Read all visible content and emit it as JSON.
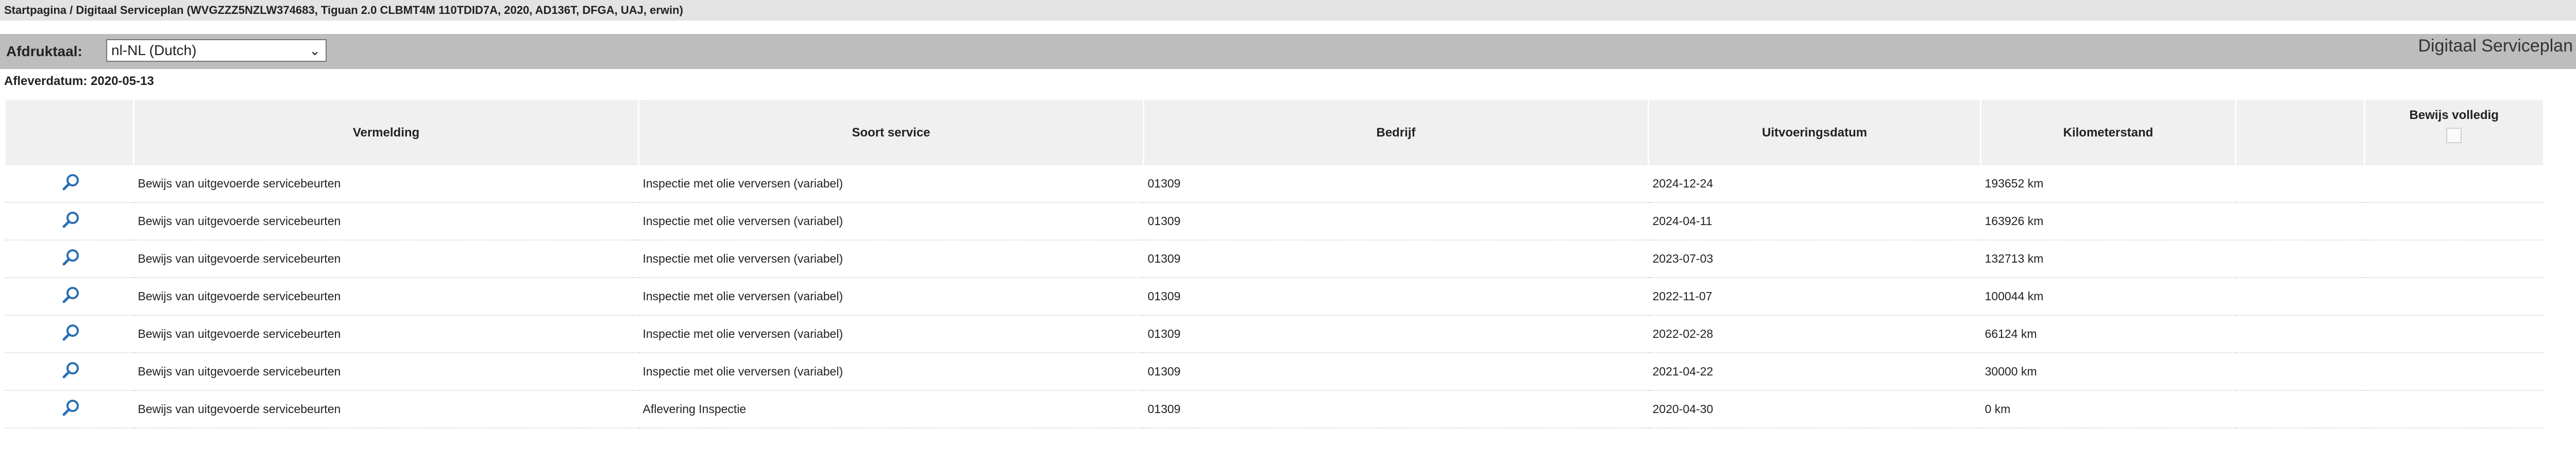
{
  "breadcrumb": "Startpagina / Digitaal Serviceplan (WVGZZZ5NZLW374683, Tiguan 2.0 CLBMT4M 110TDID7A, 2020, AD136T, DFGA, UAJ, erwin)",
  "toolbar": {
    "lang_label": "Afdruktaal:",
    "lang_value": "nl-NL (Dutch)",
    "title": "Digitaal Serviceplan"
  },
  "delivery_date": "Afleverdatum: 2020-05-13",
  "table": {
    "headers": {
      "vermelding": "Vermelding",
      "soort": "Soort service",
      "bedrijf": "Bedrijf",
      "datum": "Uitvoeringsdatum",
      "km": "Kilometerstand",
      "bewijs": "Bewijs volledig"
    },
    "rows": [
      {
        "vermelding": "Bewijs van uitgevoerde servicebeurten",
        "soort": "Inspectie met olie verversen (variabel)",
        "bedrijf": "01309",
        "datum": "2024-12-24",
        "km": "193652 km"
      },
      {
        "vermelding": "Bewijs van uitgevoerde servicebeurten",
        "soort": "Inspectie met olie verversen (variabel)",
        "bedrijf": "01309",
        "datum": "2024-04-11",
        "km": "163926 km"
      },
      {
        "vermelding": "Bewijs van uitgevoerde servicebeurten",
        "soort": "Inspectie met olie verversen (variabel)",
        "bedrijf": "01309",
        "datum": "2023-07-03",
        "km": "132713 km"
      },
      {
        "vermelding": "Bewijs van uitgevoerde servicebeurten",
        "soort": "Inspectie met olie verversen (variabel)",
        "bedrijf": "01309",
        "datum": "2022-11-07",
        "km": "100044 km"
      },
      {
        "vermelding": "Bewijs van uitgevoerde servicebeurten",
        "soort": "Inspectie met olie verversen (variabel)",
        "bedrijf": "01309",
        "datum": "2022-02-28",
        "km": "66124 km"
      },
      {
        "vermelding": "Bewijs van uitgevoerde servicebeurten",
        "soort": "Inspectie met olie verversen (variabel)",
        "bedrijf": "01309",
        "datum": "2021-04-22",
        "km": "30000 km"
      },
      {
        "vermelding": "Bewijs van uitgevoerde servicebeurten",
        "soort": "Aflevering Inspectie",
        "bedrijf": "01309",
        "datum": "2020-04-30",
        "km": "0 km"
      }
    ]
  },
  "icons": {
    "row_icon": "magnifier-icon",
    "select_chevron": "chevron-down-icon"
  },
  "colors": {
    "icon": "#2a6fb4",
    "header_bg": "#f0f0f0",
    "toolbar_bg": "#bdbdbd",
    "breadcrumb_bg": "#e3e3e3"
  }
}
